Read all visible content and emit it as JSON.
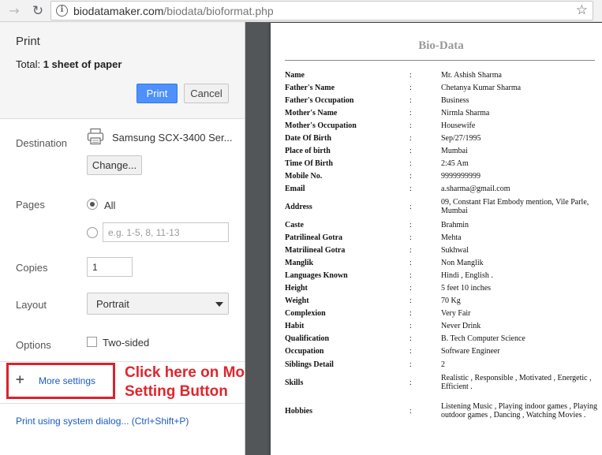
{
  "browser": {
    "back_icon": "back-arrow-icon",
    "reload_icon": "reload-icon",
    "url_host": "biodatamaker.com",
    "url_path": "/biodata/bioformat.php",
    "star_icon": "bookmark-star-icon"
  },
  "print_panel": {
    "title": "Print",
    "total_label": "Total:",
    "total_value": "1 sheet of paper",
    "print_button": "Print",
    "cancel_button": "Cancel",
    "destination_label": "Destination",
    "printer_name": "Samsung SCX-3400 Ser...",
    "change_button": "Change...",
    "pages_label": "Pages",
    "pages_all_label": "All",
    "pages_all_selected": true,
    "pages_custom_placeholder": "e.g. 1-5, 8, 11-13",
    "copies_label": "Copies",
    "copies_value": "1",
    "layout_label": "Layout",
    "layout_value": "Portrait",
    "options_label": "Options",
    "two_sided_label": "Two-sided",
    "two_sided_checked": false,
    "more_settings_label": "More settings",
    "system_dialog_link": "Print using system dialog... (Ctrl+Shift+P)"
  },
  "annotation": {
    "line1": "Click here on More",
    "line2": "Setting Button",
    "color": "#e0262d"
  },
  "document": {
    "title": "Bio-Data",
    "separator": ":",
    "rows": [
      {
        "key": "Name",
        "value": "Mr. Ashish Sharma"
      },
      {
        "key": "Father's Name",
        "value": "Chetanya Kumar Sharma"
      },
      {
        "key": "Father's Occupation",
        "value": "Business"
      },
      {
        "key": "Mother's Name",
        "value": "Nirmla Sharma"
      },
      {
        "key": "Mother's Occupation",
        "value": "Housewife"
      },
      {
        "key": "Date Of Birth",
        "value": "Sep/27/1995"
      },
      {
        "key": "Place of birth",
        "value": "Mumbai"
      },
      {
        "key": "Time Of Birth",
        "value": "2:45 Am"
      },
      {
        "key": "Mobile No.",
        "value": "9999999999"
      },
      {
        "key": "Email",
        "value": "a.sharma@gmail.com"
      },
      {
        "key": "Address",
        "value": "09, Constant Flat Embody mention, Vile Parle, Mumbai"
      },
      {
        "key": "Caste",
        "value": "Brahmin"
      },
      {
        "key": "Patrilineal Gotra",
        "value": "Mehta"
      },
      {
        "key": "Matrilineal Gotra",
        "value": "Sukhwal"
      },
      {
        "key": "Manglik",
        "value": "Non Manglik"
      },
      {
        "key": "Languages Known",
        "value": "Hindi , English ."
      },
      {
        "key": "Height",
        "value": "5 feet 10 inches"
      },
      {
        "key": "Weight",
        "value": "70 Kg"
      },
      {
        "key": "Complexion",
        "value": "Very Fair"
      },
      {
        "key": "Habit",
        "value": "Never Drink"
      },
      {
        "key": "Qualification",
        "value": "B. Tech Computer Science"
      },
      {
        "key": "Occupation",
        "value": "Software Engineer"
      },
      {
        "key": "Siblings Detail",
        "value": "2"
      },
      {
        "key": "Skills",
        "value": "Realistic , Responsible , Motivated , Energetic , Efficient ."
      },
      {
        "key": "Hobbies",
        "value": "Listening Music , Playing indoor games , Playing outdoor games , Dancing , Watching Movies ."
      }
    ]
  }
}
